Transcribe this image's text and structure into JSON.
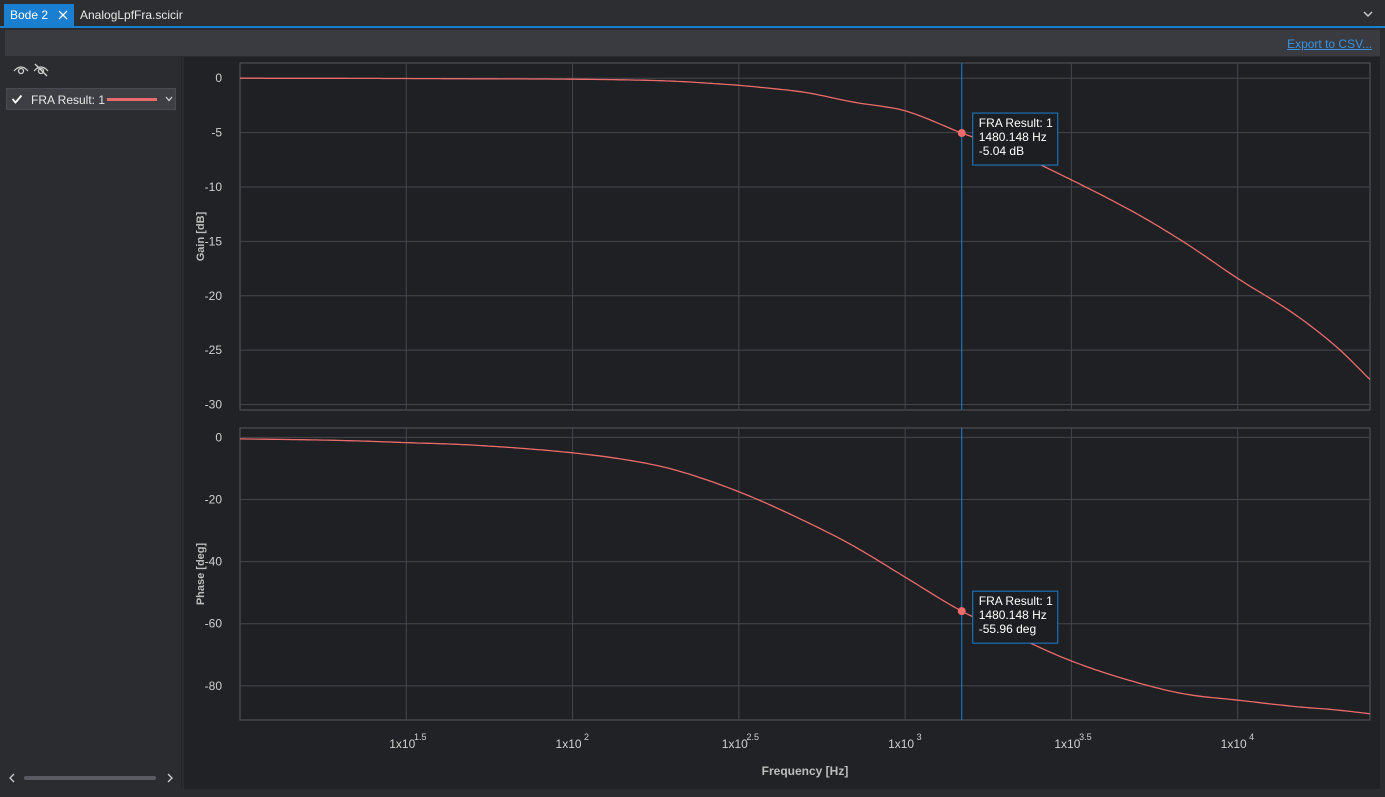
{
  "tabs": [
    {
      "label": "Bode 2",
      "active": true
    },
    {
      "label": "AnalogLpfFra.scicir",
      "active": false
    }
  ],
  "toolbar": {
    "export_label": "Export to CSV..."
  },
  "legend": {
    "series": [
      {
        "name": "FRA Result: 1",
        "checked": true,
        "color": "#ec6b6b"
      }
    ]
  },
  "colors": {
    "accent": "#1a7fd0",
    "series": "#ec6b6b",
    "cursor": "#1a7fd0",
    "grid": "#45464c"
  },
  "chart_data": [
    {
      "type": "line",
      "title": "",
      "xlabel": "Frequency [Hz]",
      "ylabel": "Gain [dB]",
      "x_scale": "log",
      "xlim": [
        10,
        25000
      ],
      "ylim": [
        -30.5,
        1.4
      ],
      "yticks": [
        0,
        -5,
        -10,
        -15,
        -20,
        -25,
        -30
      ],
      "series": [
        {
          "name": "FRA Result: 1",
          "x": [
            10,
            20,
            50,
            100,
            150,
            200,
            300,
            400,
            500,
            700,
            1000,
            1480.148,
            2000,
            3000,
            5000,
            7000,
            10000,
            15000,
            20000,
            25000
          ],
          "y": [
            0,
            -0.01,
            -0.05,
            -0.09,
            -0.16,
            -0.27,
            -0.6,
            -0.95,
            -1.3,
            -2.2,
            -3.0,
            -5.04,
            -6.5,
            -9.0,
            -12.5,
            -15.2,
            -18.4,
            -21.8,
            -24.8,
            -27.7
          ]
        }
      ],
      "cursor": {
        "series": "FRA Result: 1",
        "x_label": "1480.148 Hz",
        "y_label": "-5.04  dB",
        "x": 1480.148,
        "y": -5.04
      }
    },
    {
      "type": "line",
      "title": "",
      "xlabel": "Frequency [Hz]",
      "ylabel": "Phase [deg]",
      "x_scale": "log",
      "xlim": [
        10,
        25000
      ],
      "ylim": [
        -91,
        3
      ],
      "yticks": [
        0,
        -20,
        -40,
        -60,
        -80
      ],
      "series": [
        {
          "name": "FRA Result: 1",
          "x": [
            10,
            20,
            31.6,
            50,
            100,
            150,
            200,
            316,
            500,
            700,
            1000,
            1480.148,
            2000,
            3162,
            5000,
            7000,
            10000,
            15000,
            20000,
            25000
          ],
          "y": [
            -0.5,
            -1.0,
            -1.7,
            -2.5,
            -5.0,
            -7.5,
            -10.3,
            -17.5,
            -27,
            -35,
            -45,
            -55.96,
            -62.5,
            -72,
            -79,
            -82.7,
            -84.6,
            -86.7,
            -87.8,
            -89
          ]
        }
      ],
      "cursor": {
        "series": "FRA Result: 1",
        "x_label": "1480.148 Hz",
        "y_label": "-55.96  deg",
        "x": 1480.148,
        "y": -55.96
      }
    }
  ],
  "x_ticks": [
    {
      "base": "1x10",
      "exp": "1.5",
      "value": 31.62
    },
    {
      "base": "1x10",
      "exp": "2",
      "value": 100
    },
    {
      "base": "1x10",
      "exp": "2.5",
      "value": 316.2
    },
    {
      "base": "1x10",
      "exp": "3",
      "value": 1000
    },
    {
      "base": "1x10",
      "exp": "3.5",
      "value": 3162
    },
    {
      "base": "1x10",
      "exp": "4",
      "value": 10000
    }
  ]
}
